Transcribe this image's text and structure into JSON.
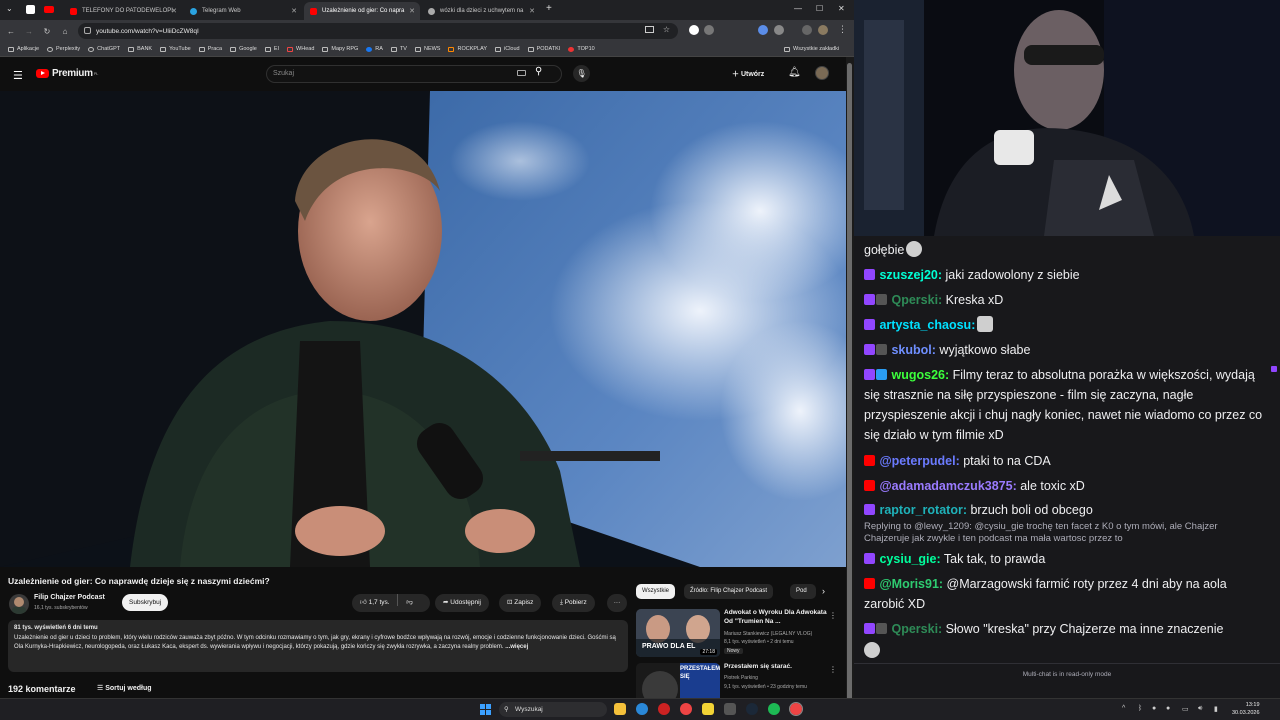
{
  "browser": {
    "tabs": [
      {
        "label": "TELEFONY DO PATODEWELOPI",
        "active": false
      },
      {
        "label": "Telegram Web",
        "active": false
      },
      {
        "label": "Uzależnienie od gier: Co napra",
        "active": true
      },
      {
        "label": "wózki dla dzieci z uchwytem na",
        "active": false
      }
    ],
    "new_tab": "+",
    "url": "youtube.com/watch?v=UliiDcZW8qI",
    "bookmarks": [
      "Aplikacje",
      "Perplexity",
      "ChatGPT",
      "BANK",
      "YouTube",
      "Praca",
      "Google",
      "EI",
      "WHead",
      "Mapy RPG",
      "RA",
      "TV",
      "NEWS",
      "ROCKPLAY",
      "iCloud",
      "PODATKI",
      "TOP10"
    ],
    "all_bookmarks": "Wszystkie zakładki"
  },
  "youtube": {
    "logo_text": "Premium",
    "logo_country": "PL",
    "search_placeholder": "Szukaj",
    "create_label": "Utwórz",
    "video": {
      "title": "Uzależnienie od gier: Co naprawdę dzieje się z naszymi dziećmi?",
      "channel": "Filip Chajzer Podcast",
      "subscribers": "16,1 tys. subskrybentów",
      "subscribe_label": "Subskrybuj",
      "likes": "1,7 tys.",
      "share_label": "Udostępnij",
      "save_label": "Zapisz",
      "download_label": "Pobierz",
      "views_date": "81 tys. wyświetleń  6 dni temu",
      "description": "Uzależnienie od gier u dzieci to problem, który wielu rodziców zauważa zbyt późno. W tym odcinku rozmawiamy o tym, jak gry, ekrany i cyfrowe bodźce wpływają na rozwój, emocje i codzienne funkcjonowanie dzieci. Gośćmi są Ola Kurnyka-Hrapkiewicz, neurologopeda, oraz Łukasz Kaca, ekspert ds. wywierania wpływu i negocjacji, którzy pokazują, gdzie kończy się zwykła rozrywka, a zaczyna realny problem.",
      "more_label": "...więcej",
      "comments_count": "192 komentarze",
      "sort_label": "Sortuj według"
    },
    "chips": [
      "Wszystkie",
      "Źródło: Filip Chajzer Podcast",
      "Pod"
    ],
    "recommended": [
      {
        "title": "Adwokat o Wyroku Dla Adwokata Od \"Trumien Na ...",
        "channel": "Mariusz Stankiewicz (LEGALNY VLOG)",
        "meta": "8,1 tys. wyświetleń • 2 dni temu",
        "badge": "Nowy",
        "thumb_text": "PRAWO DLA EL",
        "duration": "27:18"
      },
      {
        "title": "Przestałem się starać.",
        "channel": "Piotrek Parking",
        "meta": "9,1 tys. wyświetleń • 23 godziny temu",
        "thumb_text": "PRZESTAŁEM SIĘ"
      }
    ]
  },
  "chat": {
    "messages": [
      {
        "user": "",
        "text": "gołębie",
        "badges": [],
        "color": "#efeff1"
      },
      {
        "user": "szuszej20:",
        "text": " jaki zadowolony z siebie",
        "badges": [
          "tw"
        ],
        "color": "#00ffd5"
      },
      {
        "user": "Qperski:",
        "text": " Kreska xD",
        "badges": [
          "tw",
          "mod"
        ],
        "color": "#2e8b57"
      },
      {
        "user": "artysta_chaosu:",
        "text": "",
        "badges": [
          "tw"
        ],
        "color": "#00e1ff"
      },
      {
        "user": "skubol:",
        "text": " wyjątkowo słabe",
        "badges": [
          "tw",
          "mod"
        ],
        "color": "#6f8fff"
      },
      {
        "user": "wugos26:",
        "text": " Filmy teraz to absolutna porażka w większości, wydają się strasznie na siłę przyspieszone - film się zaczyna, nagłe przyspieszenie akcji i chuj nagły koniec, nawet nie wiadomo co przez co się działo w tym filmie xD",
        "badges": [
          "tw",
          "sub"
        ],
        "color": "#3cff3c"
      },
      {
        "user": "@peterpudel:",
        "text": " ptaki to na CDA",
        "badges": [
          "yt"
        ],
        "color": "#6b7bff"
      },
      {
        "user": "@adamadamczuk3875:",
        "text": " ale toxic xD",
        "badges": [
          "yt"
        ],
        "color": "#9a7bff"
      },
      {
        "user": "raptor_rotator:",
        "text": " brzuch boli od obcego",
        "badges": [
          "tw"
        ],
        "color": "#1fb2ba"
      },
      {
        "user": "cysiu_gie:",
        "text": "  Tak tak, to prawda",
        "badges": [
          "tw"
        ],
        "color": "#00ff9d"
      },
      {
        "user": "@Moris91:",
        "text": " @Marzagowski farmić roty przez 4 dni aby na aola zarobić XD",
        "badges": [
          "yt"
        ],
        "color": "#2ecc71"
      },
      {
        "user": "Qperski:",
        "text": " Słowo \"kreska\" przy Chajzerze ma inne znaczenie",
        "badges": [
          "tw",
          "mod"
        ],
        "color": "#2e8b57"
      }
    ],
    "reply_note": "Replying to @lewy_1209: @cysiu_gie trochę ten facet z K0 o tym mówi, ale Chajzer Chajzeruje jak zwykle i ten podcast ma mała wartosc przez to",
    "footer": "Multi-chat is in read-only mode"
  },
  "taskbar": {
    "search_label": "Wyszukaj",
    "time": "13:19",
    "date": "30.03.2026"
  },
  "colors": {
    "twitch": "#9146ff",
    "youtube_red": "#ff0000"
  }
}
